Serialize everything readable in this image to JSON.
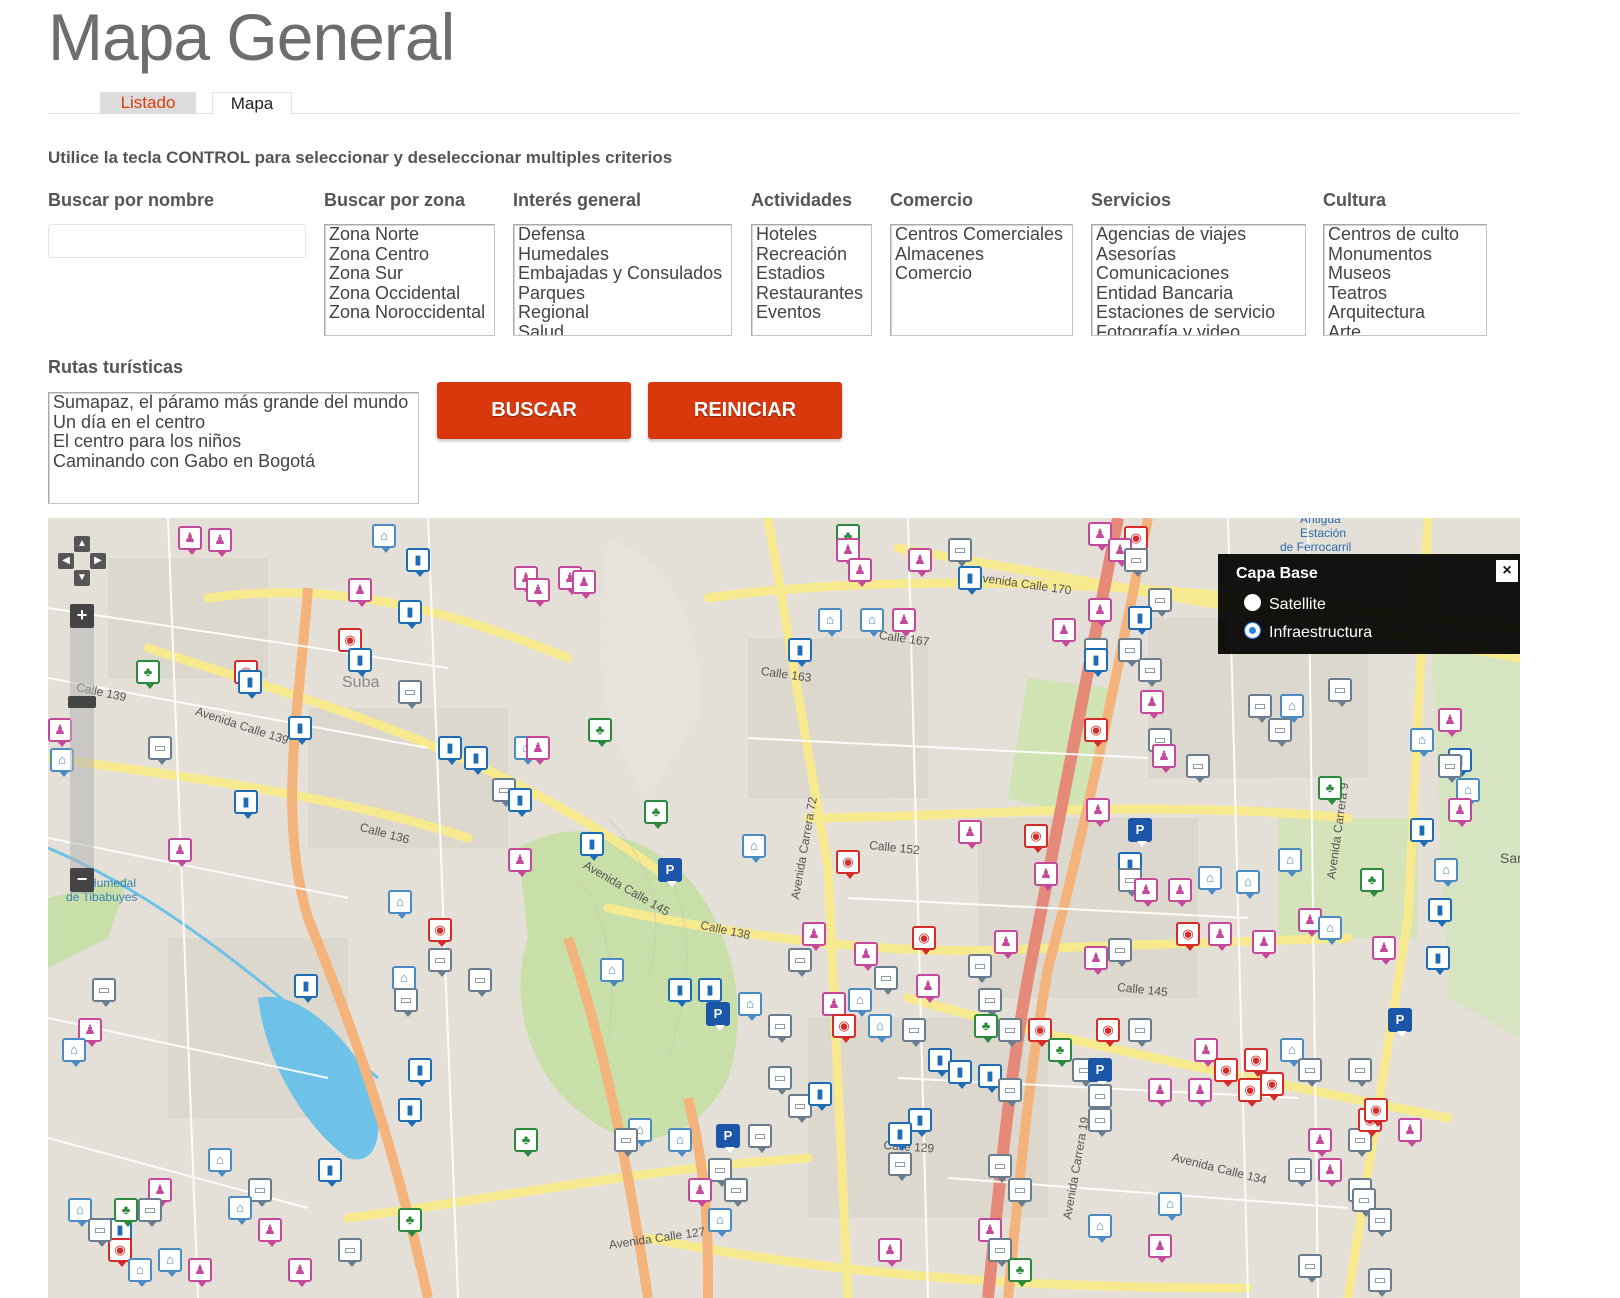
{
  "title": "Mapa General",
  "tabs": {
    "listado": "Listado",
    "mapa": "Mapa"
  },
  "instruction": "Utilice la tecla CONTROL para seleccionar y deseleccionar multiples criterios",
  "filters": {
    "nombre_label": "Buscar por nombre",
    "nombre_value": "",
    "zona_label": "Buscar por zona",
    "zona": [
      "Zona Norte",
      "Zona Centro",
      "Zona Sur",
      "Zona Occidental",
      "Zona Noroccidental"
    ],
    "interes_label": "Interés general",
    "interes": [
      "Defensa",
      "Humedales",
      "Embajadas y Consulados",
      "Parques",
      "Regional",
      "Salud"
    ],
    "actividades_label": "Actividades",
    "actividades": [
      "Hoteles",
      "Recreación",
      "Estadios",
      "Restaurantes",
      "Eventos"
    ],
    "comercio_label": "Comercio",
    "comercio": [
      "Centros Comerciales",
      "Almacenes",
      "Comercio"
    ],
    "servicios_label": "Servicios",
    "servicios": [
      "Agencias de viajes",
      "Asesorías",
      "Comunicaciones",
      "Entidad Bancaria",
      "Estaciones de servicio",
      "Fotografía y video"
    ],
    "cultura_label": "Cultura",
    "cultura": [
      "Centros de culto",
      "Monumentos",
      "Museos",
      "Teatros",
      "Arquitectura",
      "Arte"
    ]
  },
  "rutas": {
    "label": "Rutas turísticas",
    "items": [
      "Sumapaz, el páramo más grande del mundo",
      "Un día en el centro",
      "El centro para los niños",
      "Caminando con Gabo en Bogotá"
    ]
  },
  "buttons": {
    "buscar": "BUSCAR",
    "reiniciar": "REINICIAR"
  },
  "map": {
    "layer_panel": {
      "title": "Capa Base",
      "close": "×",
      "options": [
        {
          "label": "Satellite",
          "checked": false
        },
        {
          "label": "Infraestructura",
          "checked": true
        }
      ]
    },
    "zoom": {
      "in": "+",
      "out": "−"
    },
    "labels": {
      "suba": "Suba",
      "tibabuyes": "de Tibabuyes",
      "humedal": "Humedal",
      "estacion1": "Antigua",
      "estacion2": "Estación",
      "estacion3": "de Ferrocarril",
      "av170": "Avenida Calle 170",
      "av145": "Avenida Calle 145",
      "av139": "Avenida Calle 139",
      "av134": "Avenida Calle 134",
      "av127": "Avenida Calle 127",
      "c129": "Calle 129",
      "c136": "Calle 136",
      "c139": "Calle 139",
      "c152": "Calle 152",
      "c163": "Calle 163",
      "c167": "Calle 167",
      "c145": "Calle 145",
      "c138": "Calle 138",
      "cra72": "Avenida Carrera 72",
      "cra19": "Avenida Carrera 19",
      "cra9": "Avenida Carrera 9",
      "san": "San"
    },
    "colors": {
      "background": "#ece7df",
      "road_yellow": "#f7e98e",
      "road_orange": "#f3b37b",
      "park": "#c8dfa9",
      "water": "#6ec2e8",
      "main_red": "#e58a79"
    }
  }
}
